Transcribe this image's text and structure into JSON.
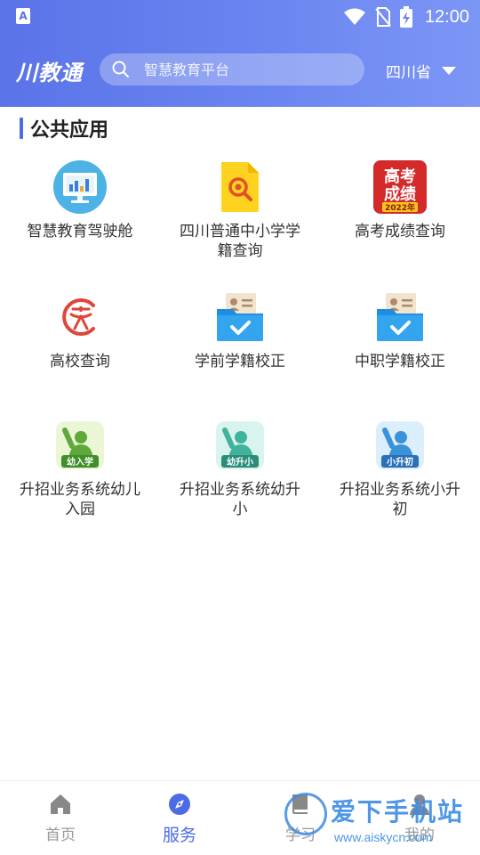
{
  "status_bar": {
    "left_icon": "A",
    "time": "12:00",
    "icons": [
      "wifi-icon",
      "no-sim-icon",
      "battery-charging-icon"
    ]
  },
  "header": {
    "logo_text": "川教通",
    "search_placeholder": "智慧教育平台",
    "province": "四川省",
    "colors": {
      "gradient_start": "#5b73e8",
      "gradient_end": "#7c96f6"
    }
  },
  "section": {
    "title": "公共应用",
    "accent": "#4d6be6"
  },
  "apps": [
    {
      "label": "智慧教育驾驶舱",
      "icon": "monitor-dashboard-icon"
    },
    {
      "label": "四川普通中小学学籍查询",
      "icon": "search-document-icon"
    },
    {
      "label": "高考成绩查询",
      "icon": "gaokao-score-icon",
      "badge_top": "高考",
      "badge_mid": "成绩",
      "badge_year": "2022年"
    },
    {
      "label": "高校查询",
      "icon": "university-icon"
    },
    {
      "label": "学前学籍校正",
      "icon": "folder-check-icon"
    },
    {
      "label": "中职学籍校正",
      "icon": "folder-check-icon"
    },
    {
      "label": "升招业务系统幼儿入园",
      "icon": "student-raise-hand-icon",
      "tag": "幼入学"
    },
    {
      "label": "升招业务系统幼升小",
      "icon": "student-raise-hand-icon",
      "tag": "幼升小"
    },
    {
      "label": "升招业务系统小升初",
      "icon": "student-raise-hand-icon",
      "tag": "小升初"
    }
  ],
  "bottom_nav": [
    {
      "label": "首页",
      "icon": "home-icon",
      "active": false
    },
    {
      "label": "服务",
      "icon": "compass-icon",
      "active": true
    },
    {
      "label": "学习",
      "icon": "book-icon",
      "active": false
    },
    {
      "label": "我的",
      "icon": "user-icon",
      "active": false
    }
  ],
  "watermark": {
    "title": "爱下手机站",
    "url": "www.aiskycn.com"
  }
}
